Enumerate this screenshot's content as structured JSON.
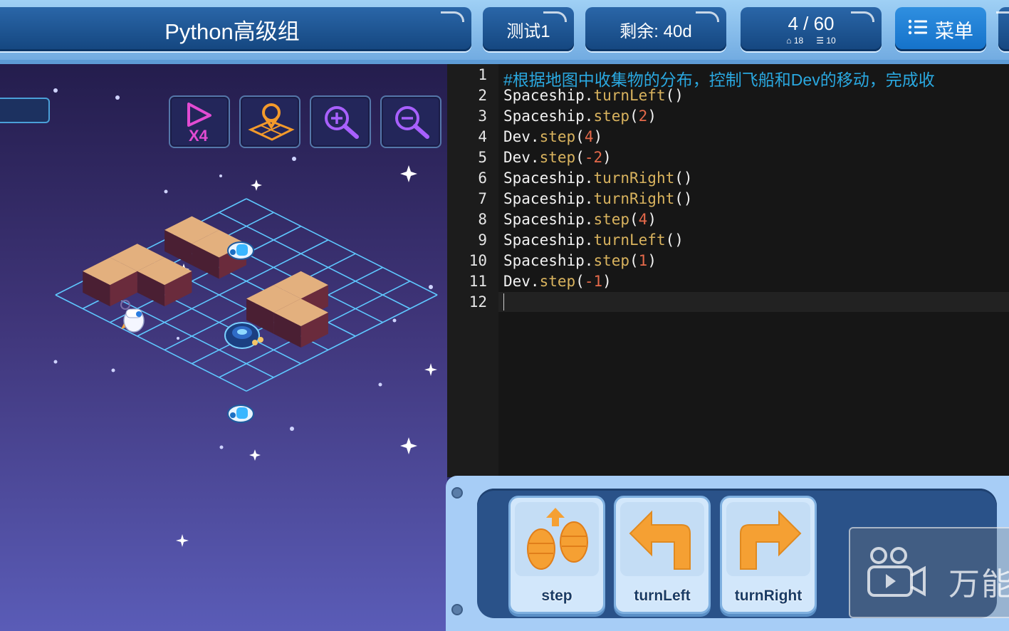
{
  "header": {
    "title": "Python高级组",
    "test_label": "测试1",
    "remaining": "剩余: 40d",
    "progress": "4 / 60",
    "stat_home": "18",
    "stat_lines": "10",
    "menu_label": "菜单"
  },
  "toolbar": {
    "speed_label": "X4"
  },
  "editor": {
    "lines": [
      {
        "num": "1",
        "text": "#根据地图中收集物的分布，控制飞船和Dev的移动，完成收"
      },
      {
        "num": "2",
        "obj": "Spaceship.",
        "method": "turnLeft",
        "open": "(",
        "arg": "",
        "close": ")"
      },
      {
        "num": "3",
        "obj": "Spaceship.",
        "method": "step",
        "open": "(",
        "arg": "2",
        "close": ")"
      },
      {
        "num": "4",
        "obj": "Dev.",
        "method": "step",
        "open": "(",
        "arg": "4",
        "close": ")"
      },
      {
        "num": "5",
        "obj": "Dev.",
        "method": "step",
        "open": "(",
        "arg": "-2",
        "close": ")"
      },
      {
        "num": "6",
        "obj": "Spaceship.",
        "method": "turnRight",
        "open": "(",
        "arg": "",
        "close": ")"
      },
      {
        "num": "7",
        "obj": "Spaceship.",
        "method": "turnRight",
        "open": "(",
        "arg": "",
        "close": ")"
      },
      {
        "num": "8",
        "obj": "Spaceship.",
        "method": "step",
        "open": "(",
        "arg": "4",
        "close": ")"
      },
      {
        "num": "9",
        "obj": "Spaceship.",
        "method": "turnLeft",
        "open": "(",
        "arg": "",
        "close": ")"
      },
      {
        "num": "10",
        "obj": "Spaceship.",
        "method": "step",
        "open": "(",
        "arg": "1",
        "close": ")"
      },
      {
        "num": "11",
        "obj": "Dev.",
        "method": "step",
        "open": "(",
        "arg": "-1",
        "close": ")"
      },
      {
        "num": "12",
        "text": ""
      }
    ]
  },
  "palette": {
    "step": "step",
    "turn_left": "turnLeft",
    "turn_right": "turnRight"
  },
  "watermark": {
    "text": "万能"
  },
  "colors": {
    "accent": "#1471c9",
    "comment": "#2aa8e0",
    "method": "#d9b35e",
    "number": "#e5694a",
    "arrow": "#f5a033"
  }
}
